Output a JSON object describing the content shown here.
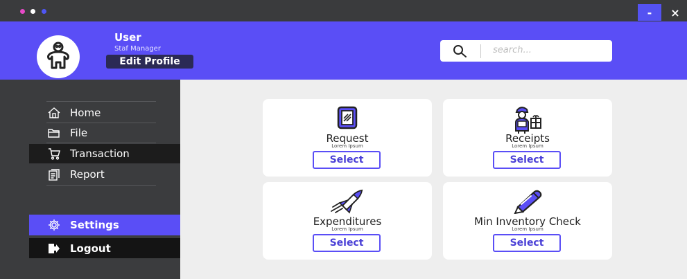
{
  "window": {
    "minimize_label": "-",
    "close_label": "×"
  },
  "header": {
    "user_name": "User",
    "user_role": "Staf Manager",
    "edit_profile": "Edit Profile",
    "search_placeholder": "search..."
  },
  "sidebar": {
    "items": [
      {
        "label": "Home",
        "icon": "home-icon"
      },
      {
        "label": "File",
        "icon": "folder-icon"
      },
      {
        "label": "Transaction",
        "icon": "cart-icon"
      },
      {
        "label": "Report",
        "icon": "report-icon"
      }
    ],
    "settings": "Settings",
    "logout": "Logout"
  },
  "cards": [
    {
      "title": "Request",
      "subtitle": "Lorem Ipsum",
      "button": "Select",
      "icon": "tablet-icon"
    },
    {
      "title": "Receipts",
      "subtitle": "Lorem Ipsum",
      "button": "Select",
      "icon": "delivery-person-icon"
    },
    {
      "title": "Expenditures",
      "subtitle": "Lorem Ipsum",
      "button": "Select",
      "icon": "rocket-icon"
    },
    {
      "title": "Min Inventory Check",
      "subtitle": "Lorem Ipsum",
      "button": "Select",
      "icon": "pencil-icon"
    }
  ],
  "colors": {
    "accent": "#5a4ef6",
    "sidebar": "#3b3c3e",
    "titlebar": "#3a3b3d",
    "content_bg": "#eeeeee"
  }
}
